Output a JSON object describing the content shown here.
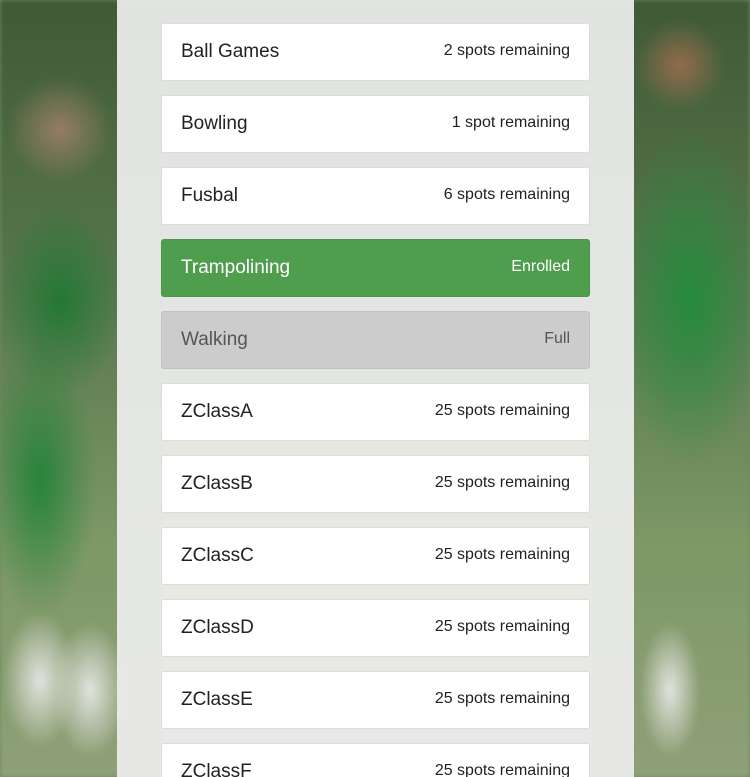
{
  "classes": [
    {
      "name": "Ball Games",
      "status": "2 spots remaining",
      "state": "available"
    },
    {
      "name": "Bowling",
      "status": "1 spot remaining",
      "state": "available"
    },
    {
      "name": "Fusbal",
      "status": "6 spots remaining",
      "state": "available"
    },
    {
      "name": "Trampolining",
      "status": "Enrolled",
      "state": "enrolled"
    },
    {
      "name": "Walking",
      "status": "Full",
      "state": "full"
    },
    {
      "name": "ZClassA",
      "status": "25 spots remaining",
      "state": "available"
    },
    {
      "name": "ZClassB",
      "status": "25 spots remaining",
      "state": "available"
    },
    {
      "name": "ZClassC",
      "status": "25 spots remaining",
      "state": "available"
    },
    {
      "name": "ZClassD",
      "status": "25 spots remaining",
      "state": "available"
    },
    {
      "name": "ZClassE",
      "status": "25 spots remaining",
      "state": "available"
    },
    {
      "name": "ZClassF",
      "status": "25 spots remaining",
      "state": "available"
    }
  ],
  "colors": {
    "enrolled": "#4f9e4e",
    "full": "#cccccc",
    "available": "#ffffff"
  }
}
